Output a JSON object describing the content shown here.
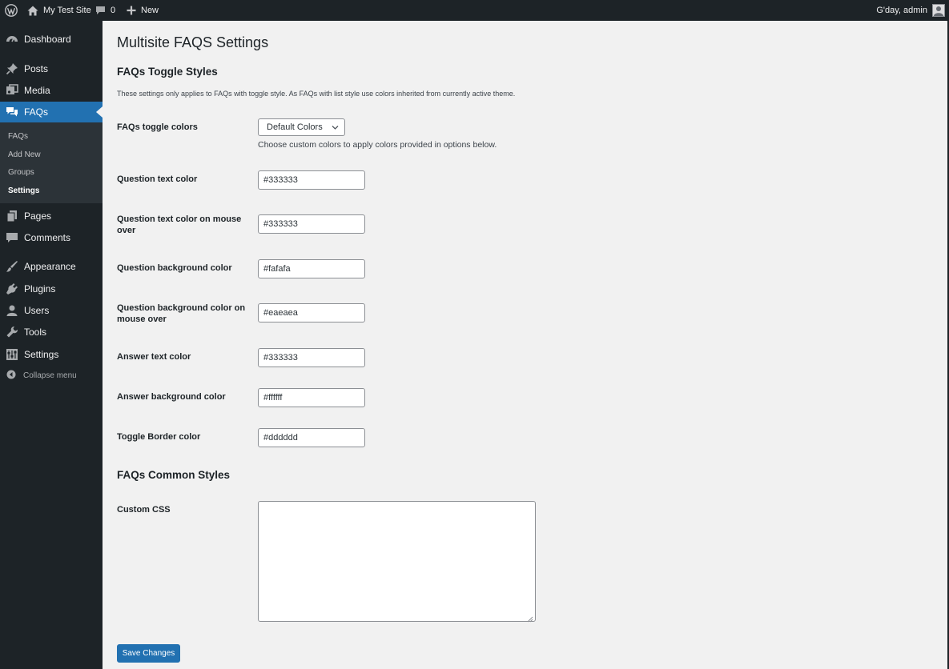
{
  "admin_bar": {
    "site_name": "My Test Site",
    "comments_count": "0",
    "new_label": "New",
    "greeting": "G'day, admin"
  },
  "sidebar": {
    "items": [
      {
        "label": "Dashboard",
        "icon": "dashboard-icon"
      },
      {
        "label": "Posts",
        "icon": "pin-icon"
      },
      {
        "label": "Media",
        "icon": "media-icon"
      },
      {
        "label": "FAQs",
        "icon": "faq-icon",
        "current": true
      },
      {
        "label": "Pages",
        "icon": "pages-icon"
      },
      {
        "label": "Comments",
        "icon": "comment-icon"
      },
      {
        "label": "Appearance",
        "icon": "brush-icon"
      },
      {
        "label": "Plugins",
        "icon": "plugin-icon"
      },
      {
        "label": "Users",
        "icon": "user-icon"
      },
      {
        "label": "Tools",
        "icon": "wrench-icon"
      },
      {
        "label": "Settings",
        "icon": "settings-icon"
      }
    ],
    "submenu": [
      {
        "label": "FAQs"
      },
      {
        "label": "Add New"
      },
      {
        "label": "Groups"
      },
      {
        "label": "Settings",
        "current": true
      }
    ],
    "collapse_label": "Collapse menu"
  },
  "page": {
    "title": "Multisite FAQS Settings",
    "toggle_section_title": "FAQs Toggle Styles",
    "toggle_section_desc": "These settings only applies to FAQs with toggle style. As FAQs with list style use colors inherited from currently active theme.",
    "toggle_colors_label": "FAQs toggle colors",
    "toggle_colors_selected": "Default Colors",
    "toggle_colors_desc": "Choose custom colors to apply colors provided in options below.",
    "fields": [
      {
        "label": "Question text color",
        "value": "#333333"
      },
      {
        "label": "Question text color on mouse over",
        "value": "#333333"
      },
      {
        "label": "Question background color",
        "value": "#fafafa"
      },
      {
        "label": "Question background color on mouse over",
        "value": "#eaeaea"
      },
      {
        "label": "Answer text color",
        "value": "#333333"
      },
      {
        "label": "Answer background color",
        "value": "#ffffff"
      },
      {
        "label": "Toggle Border color",
        "value": "#dddddd"
      }
    ],
    "common_section_title": "FAQs Common Styles",
    "custom_css_label": "Custom CSS",
    "custom_css_value": "",
    "save_label": "Save Changes"
  },
  "colors": {
    "admin_bar_bg": "#1d2327",
    "sidebar_bg": "#1d2327",
    "submenu_bg": "#2c3338",
    "accent": "#2271b1",
    "content_bg": "#f1f1f1"
  }
}
